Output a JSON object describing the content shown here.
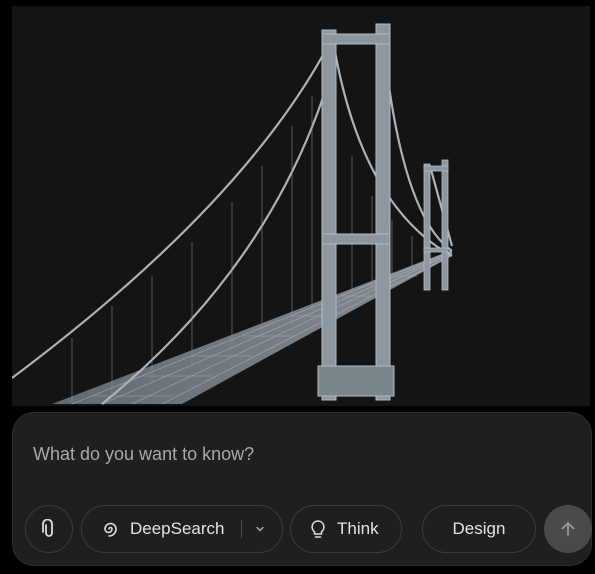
{
  "composer": {
    "placeholder": "What do you want to know?",
    "deepsearch_label": "DeepSearch",
    "think_label": "Think",
    "design_label": "Design"
  },
  "icons": {
    "attach": "paperclip-icon",
    "deepsearch": "spiral-icon",
    "dropdown": "chevron-down-icon",
    "think": "lightbulb-icon",
    "send": "arrow-up-icon"
  },
  "colors": {
    "image_background": "#141414",
    "bridge": "#8f9aa3",
    "composer_background": "#1f1f1f",
    "send_button": "#4a4a4a"
  }
}
